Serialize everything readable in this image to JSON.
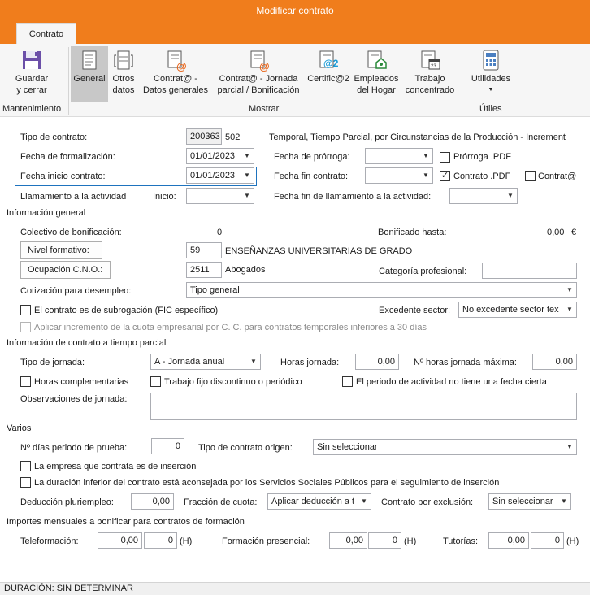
{
  "window": {
    "title": "Modificar contrato"
  },
  "tabs": [
    {
      "label": "Contrato"
    }
  ],
  "ribbon": {
    "groups": {
      "mantenimiento": "Mantenimiento",
      "mostrar": "Mostrar",
      "utiles": "Útiles"
    },
    "buttons": {
      "guardar_l1": "Guardar",
      "guardar_l2": "y cerrar",
      "general": "General",
      "otros_l1": "Otros",
      "otros_l2": "datos",
      "contrata_l1": "Contrat@ -",
      "contrata_l2": "Datos generales",
      "contrata_jornada_l1": "Contrat@ - Jornada",
      "contrata_jornada_l2": "parcial / Bonificación",
      "certifica": "Certific@2",
      "empleados_l1": "Empleados",
      "empleados_l2": "del Hogar",
      "trabajo_l1": "Trabajo",
      "trabajo_l2": "concentrado",
      "utilidades": "Utilidades"
    }
  },
  "form": {
    "tipo_contrato": {
      "label": "Tipo de contrato:",
      "code": "200363",
      "num": "502",
      "desc": "Temporal, Tiempo Parcial, por Circunstancias de la Producción - Increment"
    },
    "fecha_formalizacion": {
      "label": "Fecha de formalización:",
      "value": "01/01/2023"
    },
    "fecha_prorroga": {
      "label": "Fecha de prórroga:",
      "value": ""
    },
    "prorroga_pdf": {
      "label": "Prórroga .PDF",
      "checked": false
    },
    "fecha_inicio": {
      "label": "Fecha inicio contrato:",
      "value": "01/01/2023"
    },
    "fecha_fin": {
      "label": "Fecha fin contrato:",
      "value": ""
    },
    "contrato_pdf": {
      "label": "Contrato .PDF",
      "checked": true
    },
    "contrata_chk": {
      "label": "Contrat@",
      "checked": false
    },
    "llamamiento": {
      "label": "Llamamiento a la actividad",
      "inicio_label": "Inicio:",
      "inicio_value": ""
    },
    "fecha_fin_llamamiento": {
      "label": "Fecha fin de llamamiento a la actividad:",
      "value": ""
    }
  },
  "info_general": {
    "title": "Información general",
    "colectivo_label": "Colectivo de bonificación:",
    "colectivo_value": "0",
    "bonificado_label": "Bonificado hasta:",
    "bonificado_value": "0,00",
    "bonificado_unit": "€",
    "nivel_btn": "Nivel formativo:",
    "nivel_code": "59",
    "nivel_desc": "ENSEÑANZAS UNIVERSITARIAS DE GRADO",
    "ocupacion_btn": "Ocupación C.N.O.:",
    "ocupacion_code": "2511",
    "ocupacion_desc": "Abogados",
    "categoria_label": "Categoría profesional:",
    "categoria_value": "",
    "cotizacion_label": "Cotización para desempleo:",
    "cotizacion_value": "Tipo general",
    "subrogacion_label": "El contrato es de subrogación (FIC específico)",
    "excedente_label": "Excedente sector:",
    "excedente_value": "No excedente sector tex",
    "incremento_label": "Aplicar incremento de la cuota empresarial por C. C. para contratos temporales inferiores a 30 días"
  },
  "tiempo_parcial": {
    "title": "Información de contrato a tiempo parcial",
    "tipo_jornada_label": "Tipo de jornada:",
    "tipo_jornada_value": "A - Jornada anual",
    "horas_label": "Horas jornada:",
    "horas_value": "0,00",
    "max_label": "Nº horas jornada máxima:",
    "max_value": "0,00",
    "horas_comp_label": "Horas complementarias",
    "fijo_disc_label": "Trabajo fijo discontinuo o periódico",
    "periodo_label": "El periodo de actividad no tiene una fecha cierta",
    "obs_label": "Observaciones de jornada:",
    "obs_value": ""
  },
  "varios": {
    "title": "Varios",
    "prueba_label": "Nº días periodo de prueba:",
    "prueba_value": "0",
    "origen_label": "Tipo de contrato origen:",
    "origen_value": "Sin seleccionar",
    "insercion_label": "La empresa que contrata es de inserción",
    "duracion_label": "La duración inferior del contrato está aconsejada por los Servicios Sociales Públicos para el seguimiento de inserción",
    "deduccion_label": "Deducción pluriempleo:",
    "deduccion_value": "0,00",
    "fraccion_label": "Fracción de cuota:",
    "fraccion_value": "Aplicar deducción a t",
    "exclusion_label": "Contrato por exclusión:",
    "exclusion_value": "Sin seleccionar"
  },
  "formacion": {
    "title": "Importes mensuales a bonificar para contratos de formación",
    "teleformacion_label": "Teleformación:",
    "teleformacion_value": "0,00",
    "teleformacion_h": "0",
    "presencial_label": "Formación presencial:",
    "presencial_value": "0,00",
    "presencial_h": "0",
    "tutorias_label": "Tutorías:",
    "tutorias_value": "0,00",
    "tutorias_h": "0",
    "h_unit": "(H)"
  },
  "status": {
    "text": "DURACIÓN: SIN DETERMINAR"
  }
}
